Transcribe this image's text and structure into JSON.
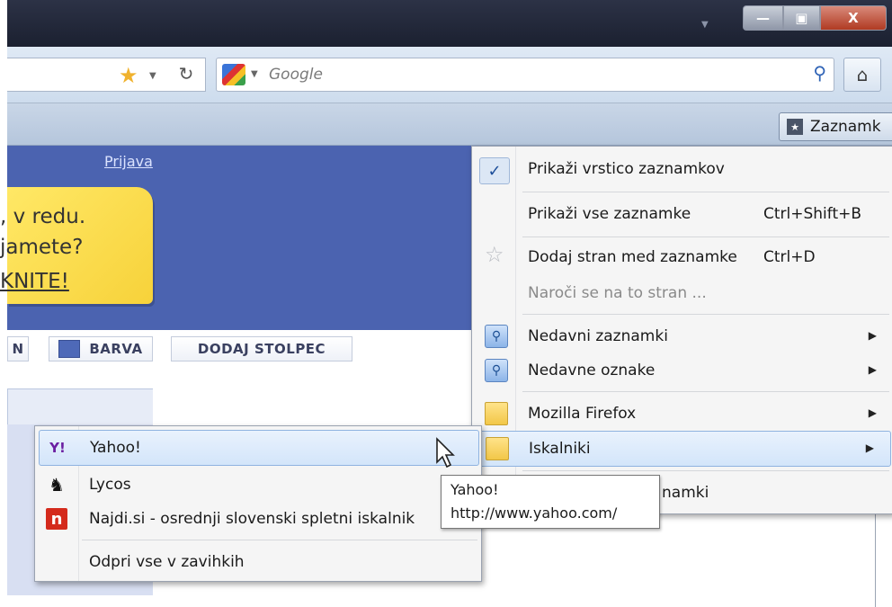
{
  "window": {
    "min": "—",
    "max": "▣",
    "close": "X"
  },
  "navbar": {
    "search_placeholder": "Google",
    "star_icon": "star-icon",
    "reload_icon": "reload-icon",
    "home_icon": "home-icon"
  },
  "bookmarks_toolbar": {
    "button_label": "Zaznamk"
  },
  "page": {
    "login_link": "Prijava",
    "note_line1": ", v redu.",
    "note_line2": "jamete?",
    "note_line3": "KNITE!",
    "tab_partial": "N",
    "tab_barva": "BARVA",
    "tab_dodaj": "DODAJ STOLPEC"
  },
  "bookmarks_menu": {
    "show_toolbar": "Prikaži vrstico zaznamkov",
    "show_all": "Prikaži vse zaznamke",
    "show_all_shortcut": "Ctrl+Shift+B",
    "add_page": "Dodaj stran med zaznamke",
    "add_page_shortcut": "Ctrl+D",
    "subscribe": "Naroči se na to stran ...",
    "recent_bookmarks": "Nedavni zaznamki",
    "recent_tags": "Nedavne oznake",
    "firefox_folder": "Mozilla Firefox",
    "search_folder": "Iskalniki",
    "partial_item": "namki"
  },
  "submenu": {
    "yahoo": "Yahoo!",
    "lycos": "Lycos",
    "najdi": "Najdi.si - osrednji slovenski spletni iskalnik",
    "open_all": "Odpri vse v zavihkih"
  },
  "tooltip": {
    "title": "Yahoo!",
    "url": "http://www.yahoo.com/"
  },
  "colors": {
    "page_blue": "#4b63b0",
    "note_yellow": "#f7d23a",
    "menu_highlight": "#d3e5fa"
  }
}
